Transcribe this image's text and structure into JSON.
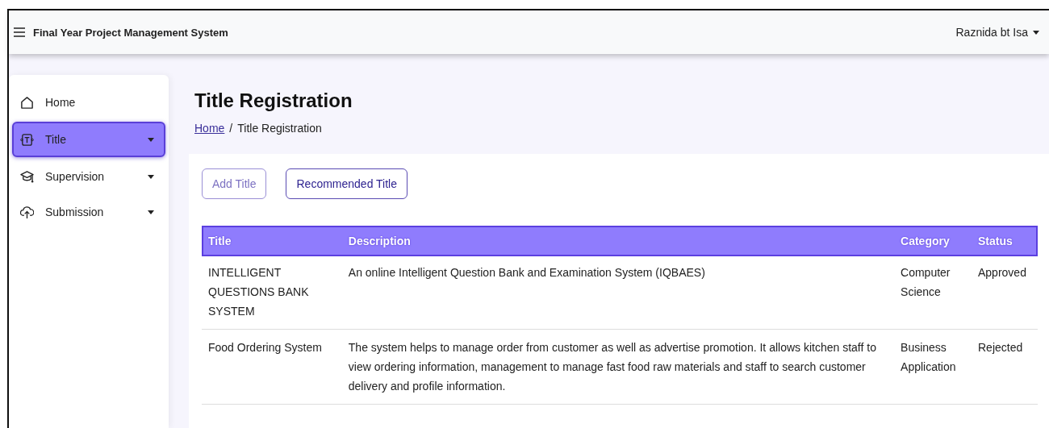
{
  "navbar": {
    "title": "Final Year Project Management System",
    "user": "Raznida bt Isa"
  },
  "sidebar": {
    "items": [
      {
        "label": "Home",
        "kind": "home",
        "selected": false,
        "has_submenu": false
      },
      {
        "label": "Title",
        "kind": "title",
        "selected": true,
        "has_submenu": true
      },
      {
        "label": "Supervision",
        "kind": "supervision",
        "selected": false,
        "has_submenu": true
      },
      {
        "label": "Submission",
        "kind": "submission",
        "selected": false,
        "has_submenu": true
      }
    ]
  },
  "page": {
    "heading": "Title Registration",
    "breadcrumb_separator": "/",
    "breadcrumb": [
      {
        "label": "Home",
        "link": true
      },
      {
        "label": "Title Registration",
        "link": false
      }
    ]
  },
  "buttons": [
    {
      "label": "Add Title",
      "disabled": true
    },
    {
      "label": "Recommended Title",
      "disabled": false
    }
  ],
  "table": {
    "columns": [
      "Title",
      "Description",
      "Category",
      "Status"
    ],
    "rows": [
      [
        "INTELLIGENT QUESTIONS BANK SYSTEM",
        "An online Intelligent Question Bank and Examination System (IQBAES)",
        "Computer Science",
        "Approved"
      ],
      [
        "Food Ordering System",
        "The system helps to manage order from customer as well as advertise promotion. It allows kitchen staff to view ordering information, management to manage fast food raw materials and staff to search customer delivery and profile information.",
        "Business Application",
        "Rejected"
      ]
    ]
  }
}
